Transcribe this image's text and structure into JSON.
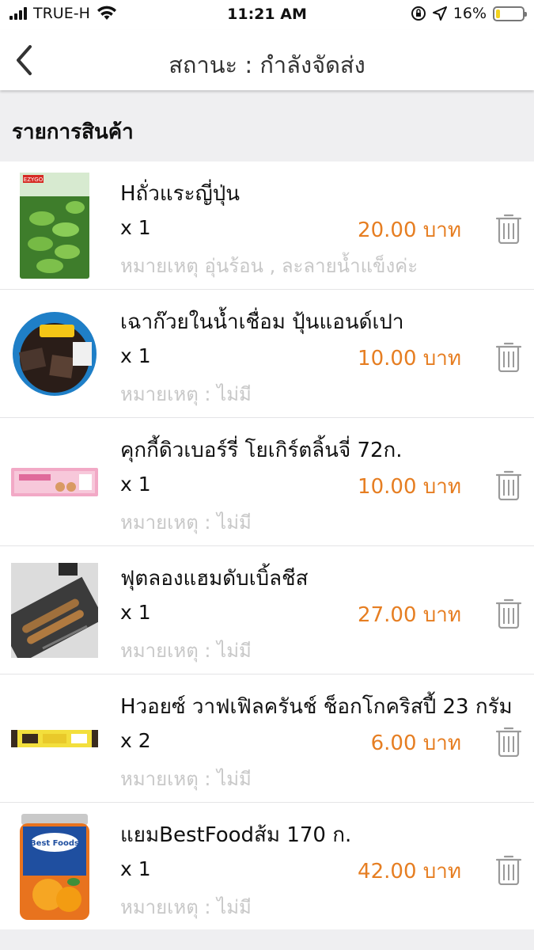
{
  "status_bar": {
    "carrier": "TRUE-H",
    "time": "11:21 AM",
    "battery": "16%",
    "battery_level": 0.16
  },
  "header": {
    "title": "สถานะ : กำลังจัดส่ง",
    "back_icon": "chevron-left-icon"
  },
  "section": {
    "title": "รายการสินค้า"
  },
  "items": [
    {
      "name": "Hถั่วแระญี่ปุ่น",
      "qty": "x 1",
      "price": "20.00 บาท",
      "note": "หมายเหตุ อุ่นร้อน , ละลายน้ำแข็งค่ะ"
    },
    {
      "name": "เฉาก๊วยในน้ำเชื่อม ปุ้นแอนด์เปา",
      "qty": "x 1",
      "price": "10.00 บาท",
      "note": "หมายเหตุ : ไม่มี"
    },
    {
      "name": "คุกกี้ดิวเบอร์รี่ โยเกิร์ตลิ้นจี่ 72ก.",
      "qty": "x 1",
      "price": "10.00 บาท",
      "note": "หมายเหตุ : ไม่มี"
    },
    {
      "name": "ฟุตลองแฮมดับเบิ้ลชีส",
      "qty": "x 1",
      "price": "27.00 บาท",
      "note": "หมายเหตุ : ไม่มี"
    },
    {
      "name": "Hวอยซ์ วาฟเฟิลครันช์ ช็อกโกคริสปี้ 23 กรัม",
      "qty": "x 2",
      "price": "6.00 บาท",
      "note": "หมายเหตุ : ไม่มี"
    },
    {
      "name": "แยมBestFoodส้ม 170 ก.",
      "qty": "x 1",
      "price": "42.00 บาท",
      "note": "หมายเหตุ : ไม่มี"
    }
  ],
  "product_logos": {
    "item1": "EZYGO",
    "item6": "Best Foods"
  },
  "colors": {
    "price": "#e67e22",
    "note": "#c8c8c8",
    "background": "#efeff1"
  }
}
